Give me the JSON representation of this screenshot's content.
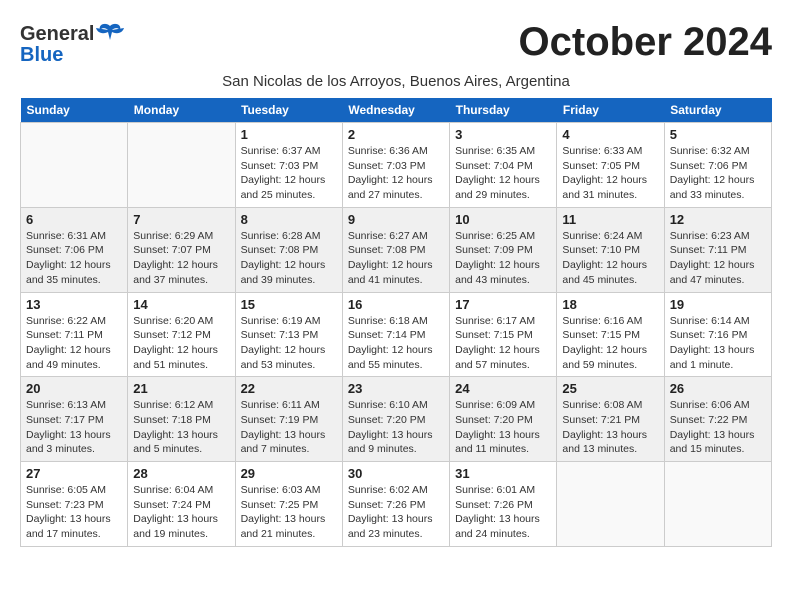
{
  "logo": {
    "line1": "General",
    "line2": "Blue"
  },
  "title": "October 2024",
  "subtitle": "San Nicolas de los Arroyos, Buenos Aires, Argentina",
  "days_of_week": [
    "Sunday",
    "Monday",
    "Tuesday",
    "Wednesday",
    "Thursday",
    "Friday",
    "Saturday"
  ],
  "weeks": [
    [
      {
        "day": "",
        "sunrise": "",
        "sunset": "",
        "daylight": ""
      },
      {
        "day": "",
        "sunrise": "",
        "sunset": "",
        "daylight": ""
      },
      {
        "day": "1",
        "sunrise": "Sunrise: 6:37 AM",
        "sunset": "Sunset: 7:03 PM",
        "daylight": "Daylight: 12 hours and 25 minutes."
      },
      {
        "day": "2",
        "sunrise": "Sunrise: 6:36 AM",
        "sunset": "Sunset: 7:03 PM",
        "daylight": "Daylight: 12 hours and 27 minutes."
      },
      {
        "day": "3",
        "sunrise": "Sunrise: 6:35 AM",
        "sunset": "Sunset: 7:04 PM",
        "daylight": "Daylight: 12 hours and 29 minutes."
      },
      {
        "day": "4",
        "sunrise": "Sunrise: 6:33 AM",
        "sunset": "Sunset: 7:05 PM",
        "daylight": "Daylight: 12 hours and 31 minutes."
      },
      {
        "day": "5",
        "sunrise": "Sunrise: 6:32 AM",
        "sunset": "Sunset: 7:06 PM",
        "daylight": "Daylight: 12 hours and 33 minutes."
      }
    ],
    [
      {
        "day": "6",
        "sunrise": "Sunrise: 6:31 AM",
        "sunset": "Sunset: 7:06 PM",
        "daylight": "Daylight: 12 hours and 35 minutes."
      },
      {
        "day": "7",
        "sunrise": "Sunrise: 6:29 AM",
        "sunset": "Sunset: 7:07 PM",
        "daylight": "Daylight: 12 hours and 37 minutes."
      },
      {
        "day": "8",
        "sunrise": "Sunrise: 6:28 AM",
        "sunset": "Sunset: 7:08 PM",
        "daylight": "Daylight: 12 hours and 39 minutes."
      },
      {
        "day": "9",
        "sunrise": "Sunrise: 6:27 AM",
        "sunset": "Sunset: 7:08 PM",
        "daylight": "Daylight: 12 hours and 41 minutes."
      },
      {
        "day": "10",
        "sunrise": "Sunrise: 6:25 AM",
        "sunset": "Sunset: 7:09 PM",
        "daylight": "Daylight: 12 hours and 43 minutes."
      },
      {
        "day": "11",
        "sunrise": "Sunrise: 6:24 AM",
        "sunset": "Sunset: 7:10 PM",
        "daylight": "Daylight: 12 hours and 45 minutes."
      },
      {
        "day": "12",
        "sunrise": "Sunrise: 6:23 AM",
        "sunset": "Sunset: 7:11 PM",
        "daylight": "Daylight: 12 hours and 47 minutes."
      }
    ],
    [
      {
        "day": "13",
        "sunrise": "Sunrise: 6:22 AM",
        "sunset": "Sunset: 7:11 PM",
        "daylight": "Daylight: 12 hours and 49 minutes."
      },
      {
        "day": "14",
        "sunrise": "Sunrise: 6:20 AM",
        "sunset": "Sunset: 7:12 PM",
        "daylight": "Daylight: 12 hours and 51 minutes."
      },
      {
        "day": "15",
        "sunrise": "Sunrise: 6:19 AM",
        "sunset": "Sunset: 7:13 PM",
        "daylight": "Daylight: 12 hours and 53 minutes."
      },
      {
        "day": "16",
        "sunrise": "Sunrise: 6:18 AM",
        "sunset": "Sunset: 7:14 PM",
        "daylight": "Daylight: 12 hours and 55 minutes."
      },
      {
        "day": "17",
        "sunrise": "Sunrise: 6:17 AM",
        "sunset": "Sunset: 7:15 PM",
        "daylight": "Daylight: 12 hours and 57 minutes."
      },
      {
        "day": "18",
        "sunrise": "Sunrise: 6:16 AM",
        "sunset": "Sunset: 7:15 PM",
        "daylight": "Daylight: 12 hours and 59 minutes."
      },
      {
        "day": "19",
        "sunrise": "Sunrise: 6:14 AM",
        "sunset": "Sunset: 7:16 PM",
        "daylight": "Daylight: 13 hours and 1 minute."
      }
    ],
    [
      {
        "day": "20",
        "sunrise": "Sunrise: 6:13 AM",
        "sunset": "Sunset: 7:17 PM",
        "daylight": "Daylight: 13 hours and 3 minutes."
      },
      {
        "day": "21",
        "sunrise": "Sunrise: 6:12 AM",
        "sunset": "Sunset: 7:18 PM",
        "daylight": "Daylight: 13 hours and 5 minutes."
      },
      {
        "day": "22",
        "sunrise": "Sunrise: 6:11 AM",
        "sunset": "Sunset: 7:19 PM",
        "daylight": "Daylight: 13 hours and 7 minutes."
      },
      {
        "day": "23",
        "sunrise": "Sunrise: 6:10 AM",
        "sunset": "Sunset: 7:20 PM",
        "daylight": "Daylight: 13 hours and 9 minutes."
      },
      {
        "day": "24",
        "sunrise": "Sunrise: 6:09 AM",
        "sunset": "Sunset: 7:20 PM",
        "daylight": "Daylight: 13 hours and 11 minutes."
      },
      {
        "day": "25",
        "sunrise": "Sunrise: 6:08 AM",
        "sunset": "Sunset: 7:21 PM",
        "daylight": "Daylight: 13 hours and 13 minutes."
      },
      {
        "day": "26",
        "sunrise": "Sunrise: 6:06 AM",
        "sunset": "Sunset: 7:22 PM",
        "daylight": "Daylight: 13 hours and 15 minutes."
      }
    ],
    [
      {
        "day": "27",
        "sunrise": "Sunrise: 6:05 AM",
        "sunset": "Sunset: 7:23 PM",
        "daylight": "Daylight: 13 hours and 17 minutes."
      },
      {
        "day": "28",
        "sunrise": "Sunrise: 6:04 AM",
        "sunset": "Sunset: 7:24 PM",
        "daylight": "Daylight: 13 hours and 19 minutes."
      },
      {
        "day": "29",
        "sunrise": "Sunrise: 6:03 AM",
        "sunset": "Sunset: 7:25 PM",
        "daylight": "Daylight: 13 hours and 21 minutes."
      },
      {
        "day": "30",
        "sunrise": "Sunrise: 6:02 AM",
        "sunset": "Sunset: 7:26 PM",
        "daylight": "Daylight: 13 hours and 23 minutes."
      },
      {
        "day": "31",
        "sunrise": "Sunrise: 6:01 AM",
        "sunset": "Sunset: 7:26 PM",
        "daylight": "Daylight: 13 hours and 24 minutes."
      },
      {
        "day": "",
        "sunrise": "",
        "sunset": "",
        "daylight": ""
      },
      {
        "day": "",
        "sunrise": "",
        "sunset": "",
        "daylight": ""
      }
    ]
  ]
}
